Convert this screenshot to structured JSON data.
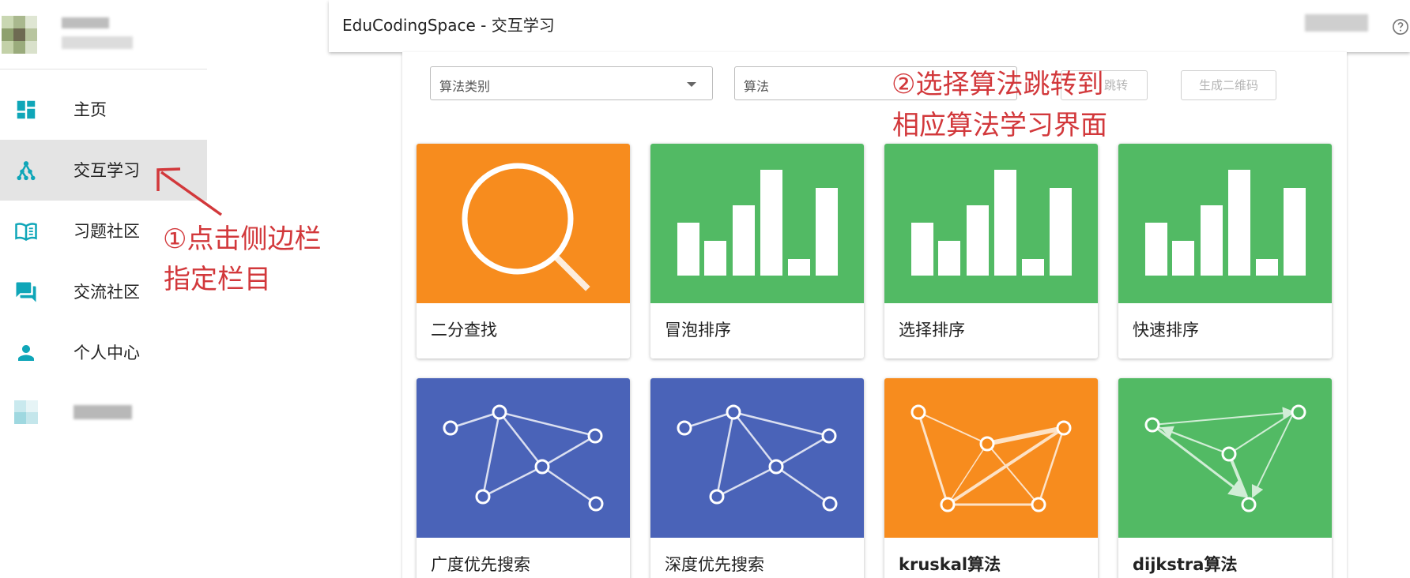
{
  "app": {
    "title": "EduCodingSpace - 交互学习"
  },
  "sidebar": {
    "items": [
      {
        "label": "主页",
        "icon": "dashboard-icon",
        "active": false
      },
      {
        "label": "交互学习",
        "icon": "hierarchy-icon",
        "active": true
      },
      {
        "label": "习题社区",
        "icon": "book-icon",
        "active": false
      },
      {
        "label": "交流社区",
        "icon": "forum-icon",
        "active": false
      },
      {
        "label": "个人中心",
        "icon": "person-icon",
        "active": false
      }
    ]
  },
  "toolbar": {
    "category_select": {
      "value": "算法类别"
    },
    "algorithm_select": {
      "value": "算法"
    },
    "jump_button": "跳转",
    "qrcode_button": "生成二维码"
  },
  "cards": [
    {
      "name": "二分查找",
      "thumb": "search-icon",
      "color": "#F78C1E"
    },
    {
      "name": "冒泡排序",
      "thumb": "bar-chart-icon",
      "color": "#52BA64"
    },
    {
      "name": "选择排序",
      "thumb": "bar-chart-icon",
      "color": "#52BA64"
    },
    {
      "name": "快速排序",
      "thumb": "bar-chart-icon",
      "color": "#52BA64"
    },
    {
      "name": "广度优先搜索",
      "thumb": "graph-icon",
      "color": "#4A63B8"
    },
    {
      "name": "深度优先搜索",
      "thumb": "graph-icon",
      "color": "#4A63B8"
    },
    {
      "name": "kruskal算法",
      "thumb": "weighted-graph-icon",
      "color": "#F78C1E"
    },
    {
      "name": "dijkstra算法",
      "thumb": "directed-graph-icon",
      "color": "#52BA64"
    }
  ],
  "annotations": {
    "step1_line1": "①点击侧边栏",
    "step1_line2": "指定栏目",
    "step2_line1": "②选择算法跳转到",
    "step2_line2": "相应算法学习界面",
    "color": "#D2383B"
  },
  "colors": {
    "accent": "#0FA6B8",
    "orange": "#F78C1E",
    "green": "#52BA64",
    "blue": "#4A63B8"
  }
}
